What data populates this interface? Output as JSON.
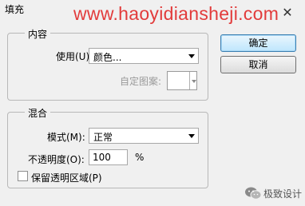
{
  "window": {
    "title": "填充"
  },
  "watermark": "www.haoyidiansheji.com",
  "content_group": {
    "title": "内容",
    "use_label": "使用(U):",
    "use_value": "颜色...",
    "custom_pattern_label": "自定图案:"
  },
  "blending_group": {
    "title": "混合",
    "mode_label": "模式(M):",
    "mode_value": "正常",
    "opacity_label": "不透明度(O):",
    "opacity_value": "100",
    "opacity_unit": "%",
    "preserve_transparency_label": "保留透明区域(P)",
    "preserve_transparency_checked": false
  },
  "buttons": {
    "ok": "确定",
    "cancel": "取消"
  },
  "brand": {
    "name": "极致设计"
  },
  "colors": {
    "watermark": "#e23b3b",
    "primary_button": "#bee6fd"
  }
}
